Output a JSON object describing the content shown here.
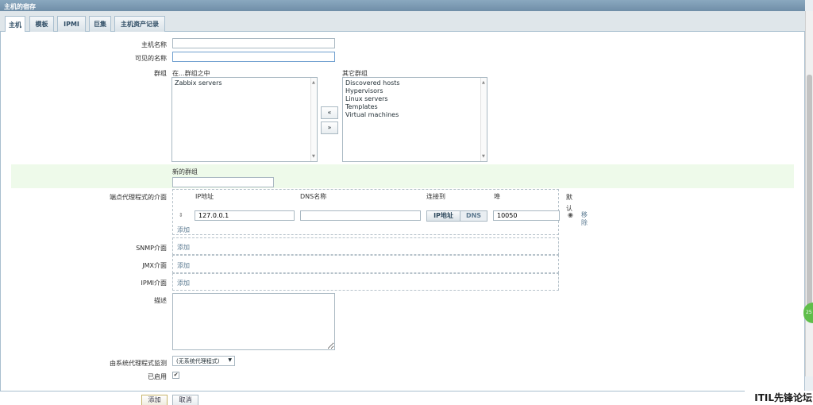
{
  "window": {
    "title": "主机的宿存"
  },
  "tabs": [
    "主机",
    "模板",
    "IPMI",
    "巨集",
    "主机资产记录"
  ],
  "form": {
    "host_name_label": "主机名称",
    "visible_name_label": "可见的名称",
    "groups_label": "群组",
    "in_groups_header": "在...群组之中",
    "other_groups_header": "其它群组",
    "in_groups": [
      "Zabbix servers"
    ],
    "other_groups": [
      "Discovered hosts",
      "Hypervisors",
      "Linux servers",
      "Templates",
      "Virtual machines"
    ],
    "move_left": "«",
    "move_right": "»",
    "new_group_label": "新的群组",
    "agent_iface_label": "端点代理程式的介面",
    "iface_headers": {
      "ip": "IP地址",
      "dns": "DNS名称",
      "connect": "连接到",
      "port": "埠",
      "default": "默认"
    },
    "agent_iface": {
      "ip": "127.0.0.1",
      "dns": "",
      "ip_btn": "IP地址",
      "dns_btn": "DNS",
      "port": "10050",
      "remove": "移除"
    },
    "add_link": "添加",
    "snmp_label": "SNMP介面",
    "jmx_label": "JMX介面",
    "ipmi_label": "IPMI介面",
    "description_label": "描述",
    "proxy_label": "由系统代理程式监测",
    "proxy_value": "(无系统代理程式)",
    "enabled_label": "已启用"
  },
  "footer": {
    "add": "添加",
    "cancel": "取消"
  },
  "overlay": {
    "bubble": "25",
    "watermark": "ITIL先锋论坛"
  }
}
